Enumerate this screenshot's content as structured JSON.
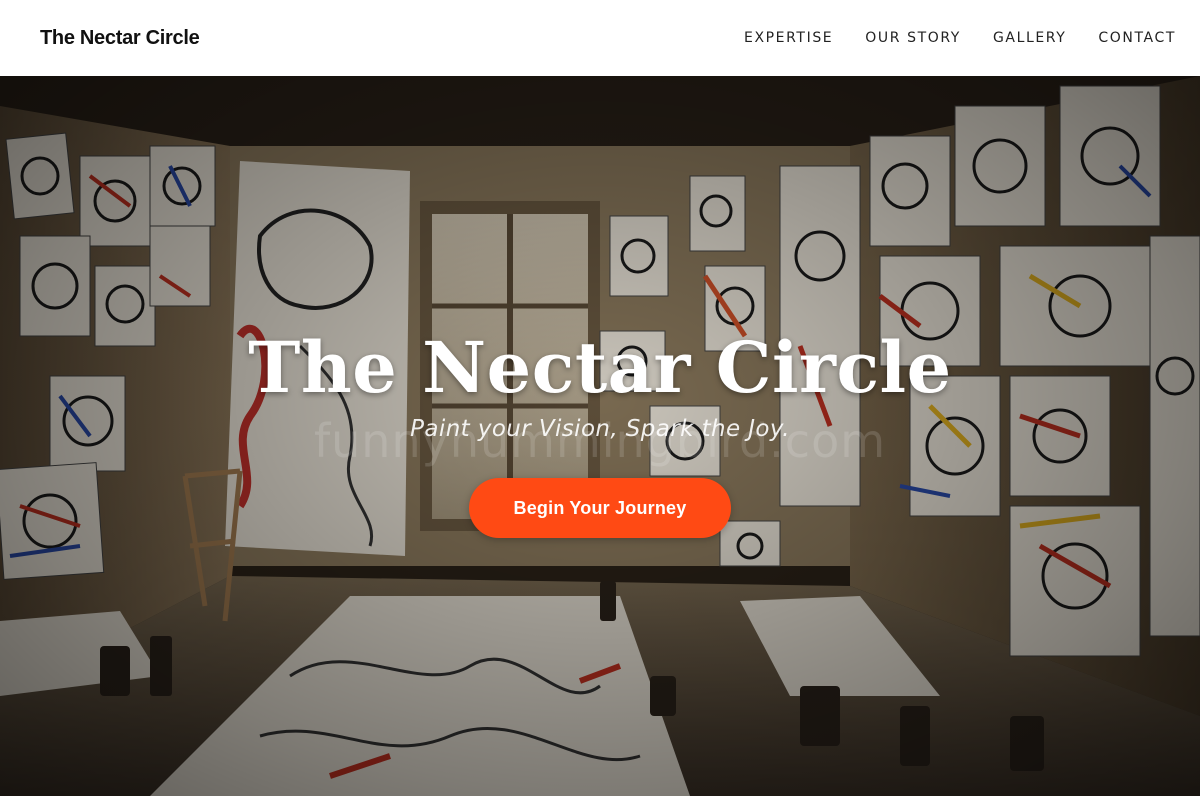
{
  "header": {
    "brand": "The Nectar Circle",
    "nav": [
      {
        "label": "EXPERTISE"
      },
      {
        "label": "OUR STORY"
      },
      {
        "label": "GALLERY"
      },
      {
        "label": "CONTACT"
      }
    ]
  },
  "hero": {
    "title": "The Nectar Circle",
    "tagline": "Paint your Vision, Spark the Joy.",
    "cta_label": "Begin Your Journey",
    "watermark": "funnyhummingbird.com",
    "image": "art-studio-room-photo"
  },
  "colors": {
    "accent": "#ff4a14",
    "header_bg": "#ffffff",
    "brand_text": "#111111"
  }
}
